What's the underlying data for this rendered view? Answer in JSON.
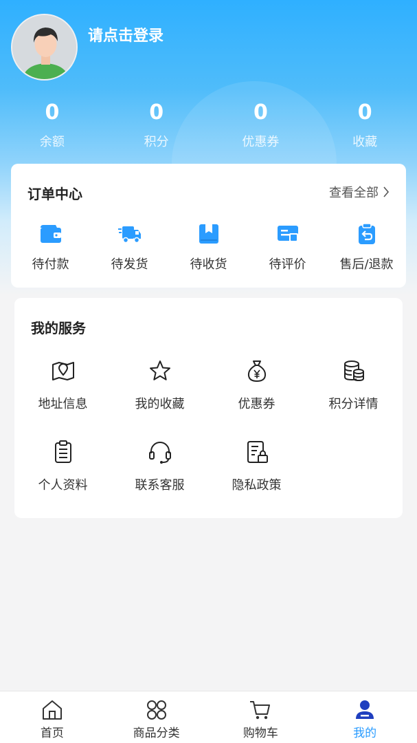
{
  "user": {
    "login_prompt": "请点击登录"
  },
  "stats": [
    {
      "value": "0",
      "label": "余额"
    },
    {
      "value": "0",
      "label": "积分"
    },
    {
      "value": "0",
      "label": "优惠券"
    },
    {
      "value": "0",
      "label": "收藏"
    }
  ],
  "orders": {
    "title": "订单中心",
    "view_all": "查看全部",
    "items": [
      {
        "label": "待付款",
        "icon": "wallet-icon"
      },
      {
        "label": "待发货",
        "icon": "truck-icon"
      },
      {
        "label": "待收货",
        "icon": "package-icon"
      },
      {
        "label": "待评价",
        "icon": "review-icon"
      },
      {
        "label": "售后/退款",
        "icon": "refund-icon"
      }
    ]
  },
  "services": {
    "title": "我的服务",
    "items": [
      {
        "label": "地址信息",
        "icon": "map-icon"
      },
      {
        "label": "我的收藏",
        "icon": "star-icon"
      },
      {
        "label": "优惠券",
        "icon": "money-bag-icon"
      },
      {
        "label": "积分详情",
        "icon": "coins-icon"
      },
      {
        "label": "个人资料",
        "icon": "clipboard-icon"
      },
      {
        "label": "联系客服",
        "icon": "headset-icon"
      },
      {
        "label": "隐私政策",
        "icon": "privacy-icon"
      }
    ]
  },
  "tabbar": {
    "items": [
      {
        "label": "首页",
        "icon": "home-icon"
      },
      {
        "label": "商品分类",
        "icon": "category-icon"
      },
      {
        "label": "购物车",
        "icon": "cart-icon"
      },
      {
        "label": "我的",
        "icon": "user-icon"
      }
    ],
    "active_index": 3
  },
  "colors": {
    "accent": "#2b9cff",
    "header_top": "#2fb0ff",
    "background": "#f4f4f5"
  }
}
